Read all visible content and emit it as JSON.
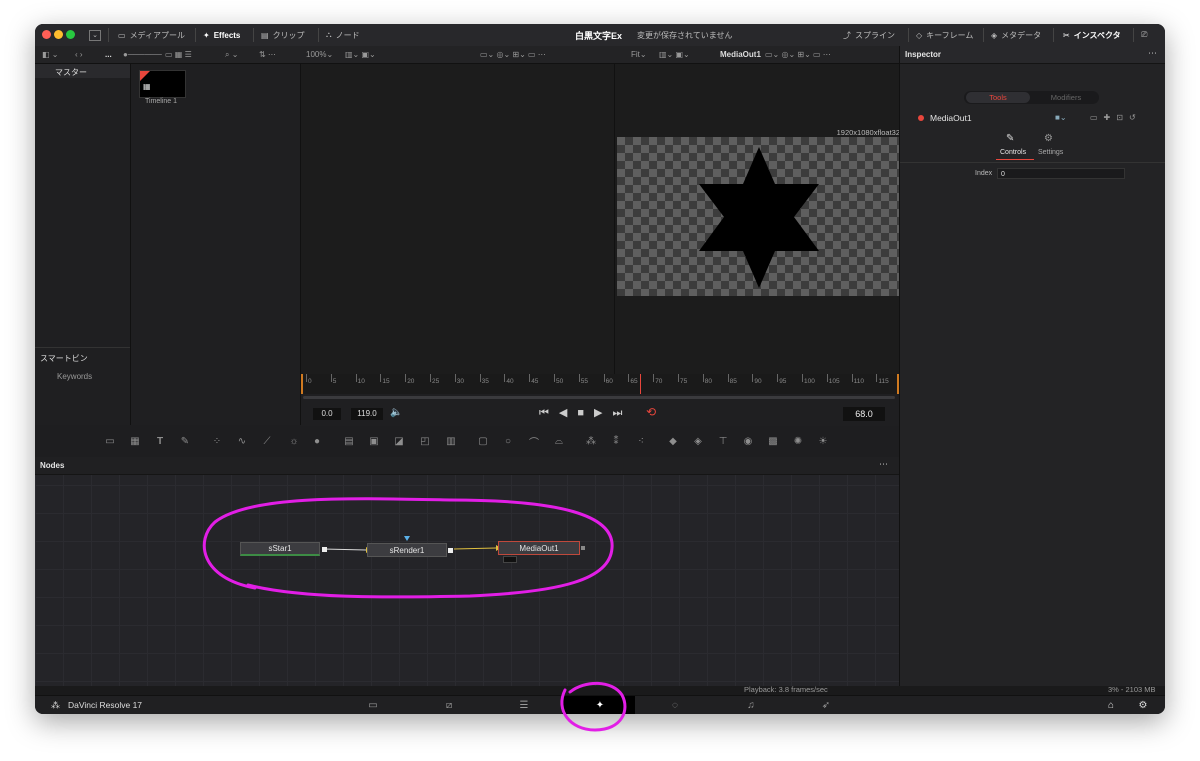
{
  "titlebar": {
    "media_pool_label": "メディアプール",
    "effects_label": "Effects",
    "clips_label": "クリップ",
    "nodes_label": "ノード",
    "project_title": "白黒文字Ex",
    "save_status": "変更が保存されていません",
    "spline_label": "スプライン",
    "keyframes_label": "キーフレーム",
    "metadata_label": "メタデータ",
    "inspector_label": "インスペクタ"
  },
  "toolbar2": {
    "zoom": "100%",
    "fit": "Fit",
    "viewer_node": "MediaOut1",
    "dots": "..."
  },
  "mediapool": {
    "master_label": "マスター",
    "smart_bins_label": "スマートビン",
    "keywords_label": "Keywords",
    "clip_name": "Timeline 1"
  },
  "viewer": {
    "resolution": "1920x1080xfloat32"
  },
  "timeline": {
    "ticks": [
      "0",
      "5",
      "10",
      "15",
      "20",
      "25",
      "30",
      "35",
      "40",
      "45",
      "50",
      "55",
      "60",
      "65",
      "70",
      "75",
      "80",
      "85",
      "90",
      "95",
      "100",
      "105",
      "110",
      "115"
    ],
    "start": "0.0",
    "end": "119.0",
    "current": "68.0"
  },
  "inspector": {
    "title": "Inspector",
    "tabs": [
      "Tools",
      "Modifiers"
    ],
    "node_name": "MediaOut1",
    "subtabs": [
      "Controls",
      "Settings"
    ],
    "field_label": "Index",
    "field_value": "0"
  },
  "nodes": {
    "title": "Nodes",
    "items": [
      "sStar1",
      "sRender1",
      "MediaOut1"
    ]
  },
  "status": {
    "playback": "Playback: 3.8 frames/sec",
    "memory": "3% - 2103 MB"
  },
  "app": {
    "name": "DaVinci Resolve 17"
  },
  "colors": {
    "annotation": "#e21ee6",
    "accent_red": "#e8463c",
    "node_out_border": "#c0493c"
  }
}
